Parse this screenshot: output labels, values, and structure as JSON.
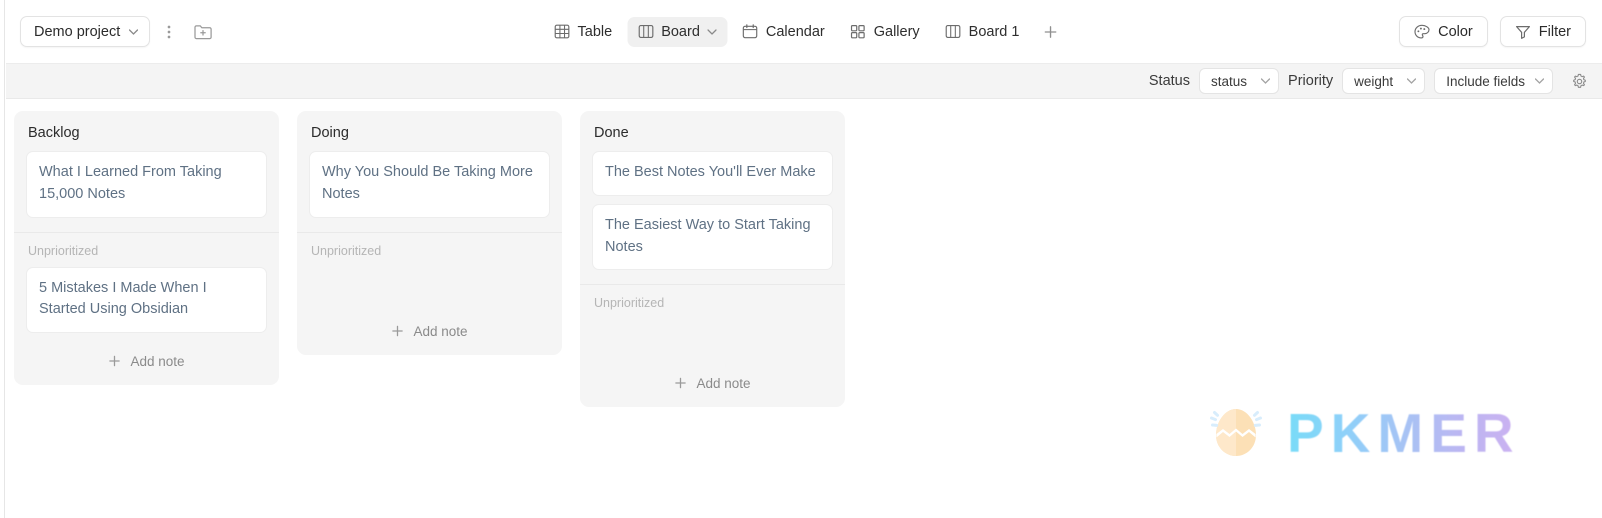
{
  "toolbar": {
    "project_name": "Demo project",
    "more_icon": "three-dots-vertical-icon",
    "new_folder_icon": "folder-plus-icon",
    "views": [
      {
        "label": "Table",
        "icon": "table-icon",
        "active": false,
        "has_chevron": false
      },
      {
        "label": "Board",
        "icon": "board-icon",
        "active": true,
        "has_chevron": true
      },
      {
        "label": "Calendar",
        "icon": "calendar-icon",
        "active": false,
        "has_chevron": false
      },
      {
        "label": "Gallery",
        "icon": "gallery-icon",
        "active": false,
        "has_chevron": false
      },
      {
        "label": "Board 1",
        "icon": "board-icon",
        "active": false,
        "has_chevron": false
      }
    ],
    "add_view_icon": "plus-icon",
    "color_button": "Color",
    "color_icon": "palette-icon",
    "filter_button": "Filter",
    "filter_icon": "funnel-icon"
  },
  "config_bar": {
    "status_label": "Status",
    "status_value": "status",
    "priority_label": "Priority",
    "priority_value": "weight",
    "include_fields_value": "Include fields",
    "settings_icon": "gear-icon"
  },
  "board": {
    "add_note_label": "Add note",
    "add_note_icon": "plus-icon",
    "columns": [
      {
        "title": "Backlog",
        "groups": [
          {
            "label": null,
            "cards": [
              "What I Learned From Taking 15,000 Notes"
            ]
          },
          {
            "label": "Unprioritized",
            "cards": [
              "5 Mistakes I Made When I Started Using Obsidian"
            ]
          }
        ]
      },
      {
        "title": "Doing",
        "groups": [
          {
            "label": null,
            "cards": [
              "Why You Should Be Taking More Notes"
            ]
          },
          {
            "label": "Unprioritized",
            "cards": []
          }
        ]
      },
      {
        "title": "Done",
        "groups": [
          {
            "label": null,
            "cards": [
              "The Best Notes You'll Ever Make",
              "The Easiest Way to Start Taking Notes"
            ]
          },
          {
            "label": "Unprioritized",
            "cards": []
          }
        ]
      }
    ]
  },
  "watermark": {
    "text": "PKMER",
    "logo_icon": "cracked-egg-icon",
    "gradient_start": "#62d6f7",
    "gradient_end": "#c4a4ef"
  }
}
